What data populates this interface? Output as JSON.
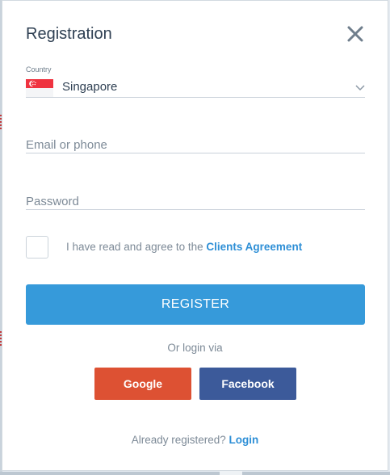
{
  "modal": {
    "title": "Registration",
    "close_icon": "close-icon"
  },
  "country": {
    "label": "Country",
    "value": "Singapore",
    "flag_icon": "singapore-flag-icon",
    "dropdown_icon": "chevron-down-icon"
  },
  "email": {
    "placeholder": "Email or phone",
    "value": ""
  },
  "password": {
    "placeholder": "Password",
    "value": ""
  },
  "agreement": {
    "checked": false,
    "text": "I have read and agree to the",
    "link_text": "Clients Agreement"
  },
  "register": {
    "label": "REGISTER"
  },
  "social": {
    "or_text": "Or login via",
    "google_label": "Google",
    "facebook_label": "Facebook"
  },
  "footer": {
    "already_text": "Already registered?",
    "login_label": "Login"
  },
  "colors": {
    "accent": "#369ada",
    "link": "#2e8fd6",
    "google": "#dd5133",
    "facebook": "#3c5a9a"
  }
}
